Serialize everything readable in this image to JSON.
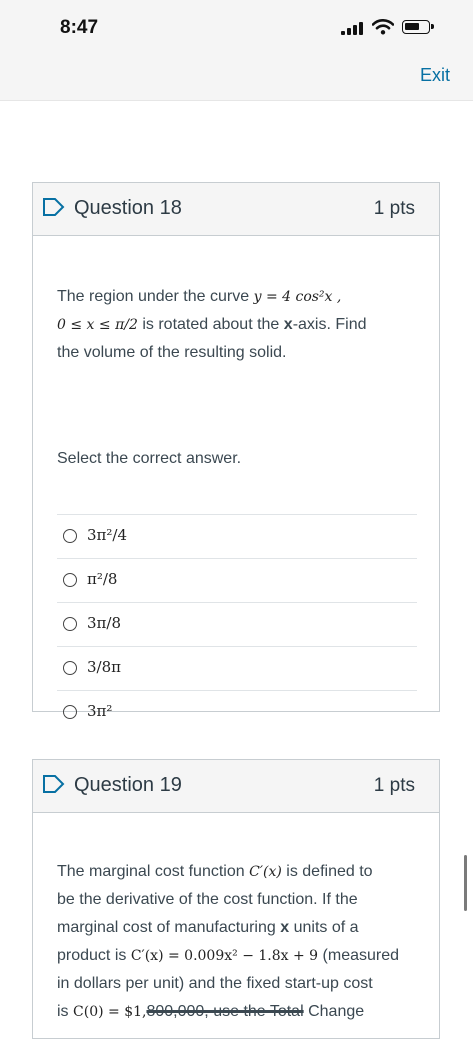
{
  "status": {
    "time": "8:47"
  },
  "topbar": {
    "exit_label": "Exit"
  },
  "q18": {
    "title": "Question 18",
    "points": "1 pts",
    "text_1": "The region under the curve",
    "curve": "y = 4 cos²x ,",
    "domain": "0 ≤ x ≤ π/2",
    "text_2": "is rotated about the",
    "axis": "x",
    "text_3": "-axis. Find",
    "text_4": "the volume of the resulting solid.",
    "prompt": "Select the correct answer.",
    "options": [
      "3π²/4",
      "π²/8",
      "3π/8",
      "3/8π",
      "3π²"
    ]
  },
  "q19": {
    "title": "Question 19",
    "points": "1 pts",
    "text_1": "The marginal cost function",
    "cprime": "C′(x)",
    "text_2": "is defined to",
    "text_3": "be the derivative of the cost function. If the",
    "text_4": "marginal cost of manufacturing",
    "xvar": "x",
    "text_5": "units of a",
    "text_6": "product is",
    "formula": "C′(x) = 0.009x² − 1.8x + 9",
    "text_7": "(measured",
    "text_8": "in dollars per unit) and the fixed start-up cost",
    "text_9": "is",
    "c0": "C(0) = $1,",
    "struck": "800,000, use the Total",
    "text_10": "Change"
  }
}
